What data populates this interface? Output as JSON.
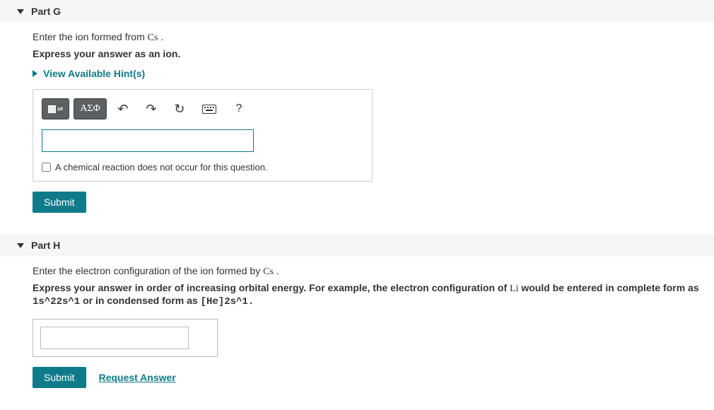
{
  "parts": {
    "g": {
      "title": "Part G",
      "prompt_pre": "Enter the ion formed from ",
      "prompt_symbol": "Cs",
      "prompt_post": " .",
      "instructions": "Express your answer as an ion.",
      "hints_label": "View Available Hint(s)",
      "toolbar": {
        "template": "reaction-template-icon",
        "greek": "ΑΣΦ",
        "undo": "↶",
        "redo": "↷",
        "reset": "↻",
        "keyboard": "keyboard-icon",
        "help": "?"
      },
      "checkbox_label": "A chemical reaction does not occur for this question.",
      "submit_label": "Submit"
    },
    "h": {
      "title": "Part H",
      "prompt_pre": "Enter the electron configuration of the ion formed by ",
      "prompt_symbol": "Cs",
      "prompt_post": " .",
      "instr1": "Express your answer in order of increasing orbital energy. For example, the electron configuration of ",
      "instr_symbol": "Li",
      "instr2": " would be entered in complete form as ",
      "instr_code1": "1s^22s^1",
      "instr3": " or in condensed form as ",
      "instr_code2": "[He]2s^1.",
      "submit_label": "Submit",
      "request_label": "Request Answer"
    }
  }
}
